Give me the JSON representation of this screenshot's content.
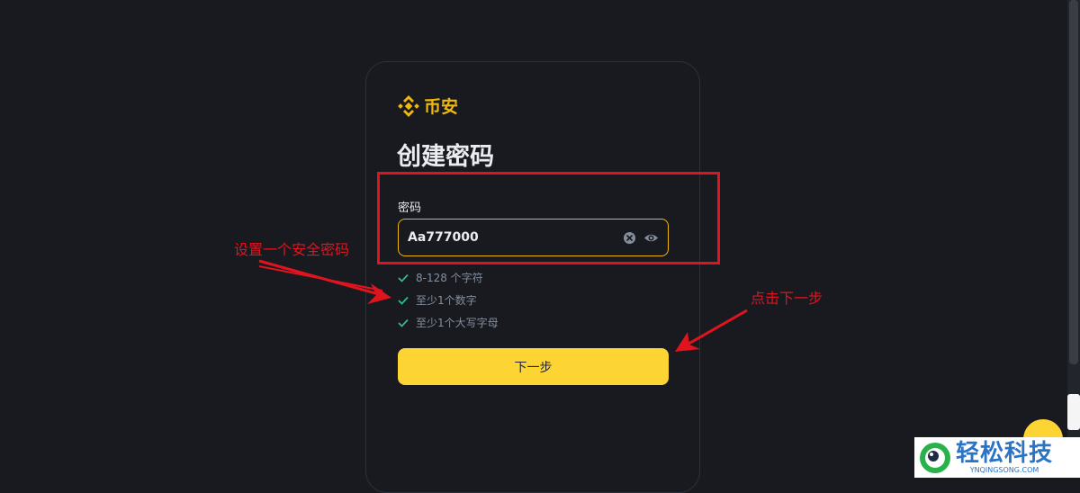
{
  "brand": {
    "name": "币安",
    "logo_icon": "binance-logo-icon",
    "color": "#f0b90b"
  },
  "form": {
    "title": "创建密码",
    "password_label": "密码",
    "password_value": "Aa777000",
    "clear_icon": "clear-icon",
    "show_icon": "eye-icon",
    "rules": [
      {
        "text": "8-128 个字符",
        "met": true
      },
      {
        "text": "至少1个数字",
        "met": true
      },
      {
        "text": "至少1个大写字母",
        "met": true
      }
    ],
    "next_button": "下一步"
  },
  "annotations": {
    "left_note": "设置一个安全密码",
    "right_note": "点击下一步",
    "color": "#e0141e"
  },
  "watermark": {
    "title": "轻松科技",
    "subtitle": "YNQINGSONG.COM"
  },
  "colors": {
    "background": "#181a20",
    "accent": "#fcd535",
    "check": "#2ebd85"
  }
}
